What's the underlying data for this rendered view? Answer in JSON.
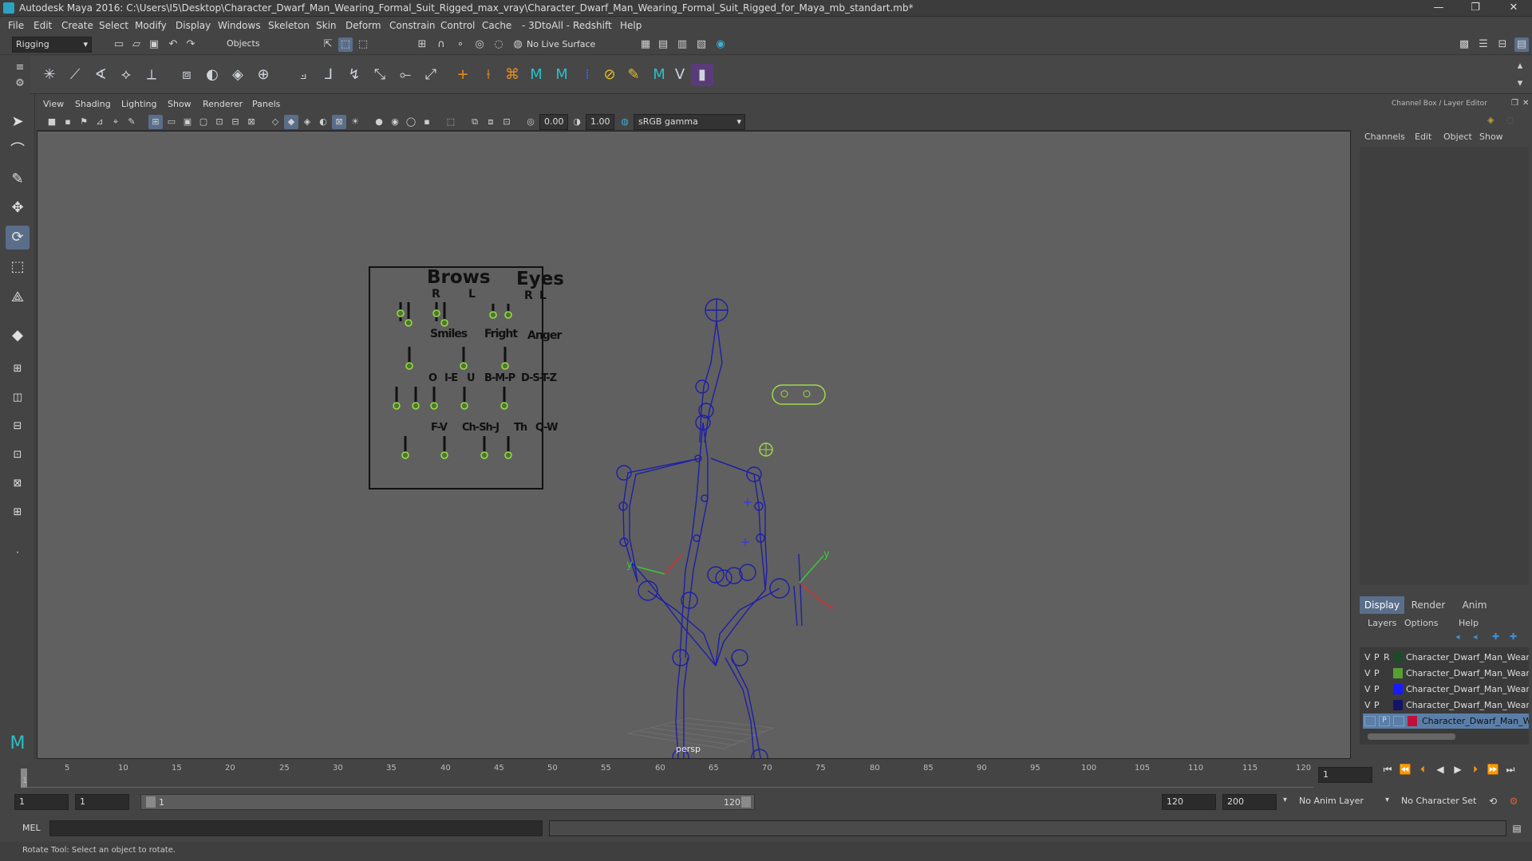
{
  "window": {
    "title": "Autodesk Maya 2016: C:\\Users\\I5\\Desktop\\Character_Dwarf_Man_Wearing_Formal_Suit_Rigged_max_vray\\Character_Dwarf_Man_Wearing_Formal_Suit_Rigged_for_Maya_mb_standart.mb*",
    "minimize": "—",
    "restore": "❐",
    "close": "✕"
  },
  "menus": [
    "File",
    "Edit",
    "Create",
    "Select",
    "Modify",
    "Display",
    "Windows",
    "Skeleton",
    "Skin",
    "Deform",
    "Constrain",
    "Control",
    "Cache",
    "- 3DtoAll -",
    "Redshift",
    "Help"
  ],
  "status": {
    "mode": "Rigging",
    "selection_mask": "Objects",
    "live_surface": "No Live Surface"
  },
  "viewport_menus": [
    "View",
    "Shading",
    "Lighting",
    "Show",
    "Renderer",
    "Panels"
  ],
  "viewport_toolbar": {
    "exposure": "0.00",
    "gamma": "1.00",
    "color_space": "sRGB gamma"
  },
  "viewport": {
    "camera_label": "persp",
    "axis_y": "y",
    "axis_x": "x",
    "axis_z": "z"
  },
  "facial_panel": {
    "headers": {
      "brows": "Brows",
      "eyes": "Eyes",
      "r1": "R",
      "l1": "L",
      "r2": "R",
      "l2": "L"
    },
    "row1": [
      "Smiles",
      "Fright",
      "Anger"
    ],
    "row2": [
      "O",
      "I-E",
      "U",
      "B-M-P",
      "D-S-T-Z"
    ],
    "row3": [
      "F-V",
      "Ch-Sh-J",
      "Th",
      "Q-W"
    ]
  },
  "channel_box": {
    "title": "Channel Box / Layer Editor",
    "menus": [
      "Channels",
      "Edit",
      "Object",
      "Show"
    ]
  },
  "layer_editor": {
    "tabs": [
      "Display",
      "Render",
      "Anim"
    ],
    "menus": [
      "Layers",
      "Options",
      "Help"
    ],
    "layers": [
      {
        "v": "V",
        "p": "P",
        "r": "R",
        "color": "#1f4a2a",
        "name": "Character_Dwarf_Man_Weari"
      },
      {
        "v": "V",
        "p": "P",
        "r": "",
        "color": "#55a032",
        "name": "Character_Dwarf_Man_Weari"
      },
      {
        "v": "V",
        "p": "P",
        "r": "",
        "color": "#1a1aff",
        "name": "Character_Dwarf_Man_Weari"
      },
      {
        "v": "V",
        "p": "P",
        "r": "",
        "color": "#141466",
        "name": "Character_Dwarf_Man_Weari"
      },
      {
        "v": "",
        "p": "P",
        "r": "",
        "color": "#c0103a",
        "name": "Character_Dwarf_Man_W"
      }
    ]
  },
  "timeline": {
    "ticks": [
      "1",
      "5",
      "10",
      "15",
      "20",
      "25",
      "30",
      "35",
      "40",
      "45",
      "50",
      "55",
      "60",
      "65",
      "70",
      "75",
      "80",
      "85",
      "90",
      "95",
      "100",
      "105",
      "110",
      "115",
      "120"
    ],
    "current_frame": "1"
  },
  "range": {
    "start": "1",
    "start_inner": "1",
    "slider_start": "1",
    "slider_end": "120",
    "end_inner": "120",
    "end": "200",
    "anim_layer": "No Anim Layer",
    "character_set": "No Character Set"
  },
  "command_line": {
    "label": "MEL"
  },
  "help_line": "Rotate Tool: Select an object to rotate."
}
